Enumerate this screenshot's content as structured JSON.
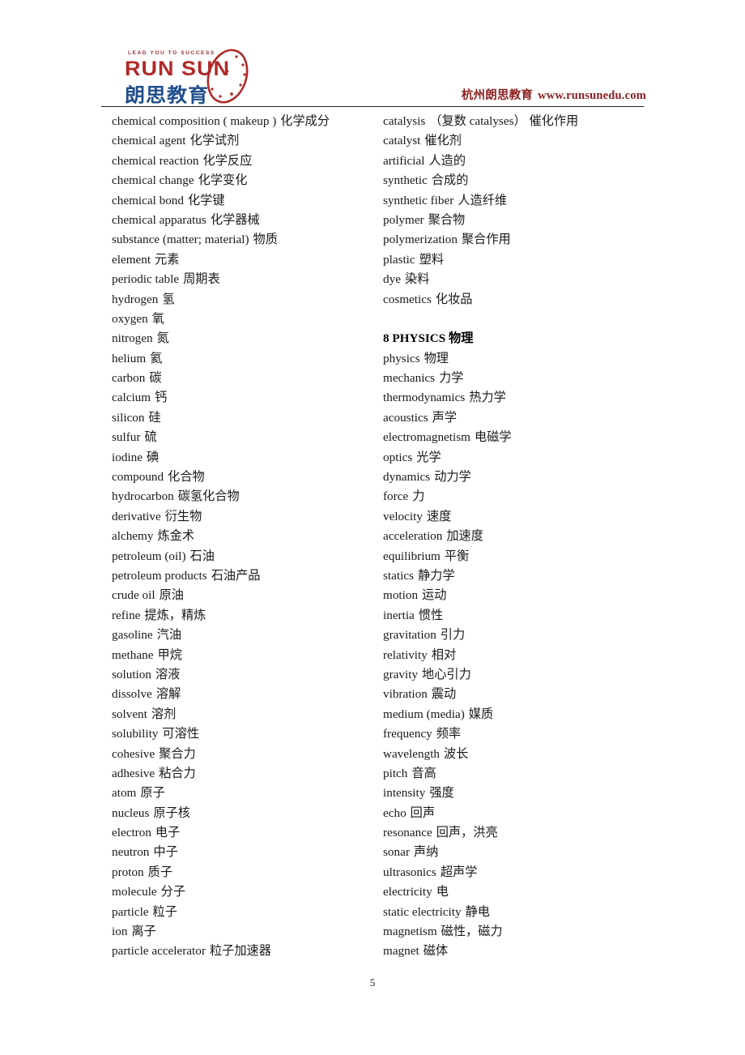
{
  "header": {
    "logo": {
      "tagline": "LEAD YOU TO SUCCESS",
      "name_en": "RUN SUN",
      "name_cn": "朗思教育"
    },
    "site_text": "杭州朗思教育",
    "site_url": "www.runsunedu.com",
    "brand_color": "#8b2121",
    "logo_blue": "#1f4e8c",
    "logo_red": "#b02a2a"
  },
  "left_column": [
    {
      "term": "chemical composition ( makeup )",
      "cn": "化学成分"
    },
    {
      "term": "chemical agent",
      "cn": "化学试剂"
    },
    {
      "term": "chemical reaction",
      "cn": "化学反应"
    },
    {
      "term": "chemical change",
      "cn": "化学变化"
    },
    {
      "term": "chemical bond",
      "cn": "化学键"
    },
    {
      "term": "chemical apparatus",
      "cn": "化学器械"
    },
    {
      "term": "substance (matter; material)",
      "cn": "物质"
    },
    {
      "term": "element",
      "cn": "元素"
    },
    {
      "term": "periodic table",
      "cn": "周期表"
    },
    {
      "term": "hydrogen",
      "cn": "氢"
    },
    {
      "term": "oxygen",
      "cn": "氧"
    },
    {
      "term": "nitrogen",
      "cn": "氮"
    },
    {
      "term": "helium",
      "cn": "氦"
    },
    {
      "term": "carbon",
      "cn": "碳"
    },
    {
      "term": "calcium",
      "cn": "钙"
    },
    {
      "term": "silicon",
      "cn": "硅"
    },
    {
      "term": "sulfur",
      "cn": "硫"
    },
    {
      "term": "iodine",
      "cn": "碘"
    },
    {
      "term": "compound",
      "cn": "化合物"
    },
    {
      "term": "hydrocarbon",
      "cn": "碳氢化合物"
    },
    {
      "term": "derivative",
      "cn": "衍生物"
    },
    {
      "term": "alchemy",
      "cn": "炼金术"
    },
    {
      "term": "petroleum (oil)",
      "cn": "石油"
    },
    {
      "term": "petroleum products",
      "cn": "石油产品"
    },
    {
      "term": "crude oil",
      "cn": "原油"
    },
    {
      "term": "refine",
      "cn": "提炼，精炼"
    },
    {
      "term": "gasoline",
      "cn": "汽油"
    },
    {
      "term": "methane",
      "cn": "甲烷"
    },
    {
      "term": "solution",
      "cn": "溶液"
    },
    {
      "term": "dissolve",
      "cn": "溶解"
    },
    {
      "term": "solvent",
      "cn": "溶剂"
    },
    {
      "term": "solubility",
      "cn": "可溶性"
    },
    {
      "term": "cohesive",
      "cn": "聚合力"
    },
    {
      "term": "adhesive",
      "cn": "粘合力"
    },
    {
      "term": "atom",
      "cn": "原子"
    },
    {
      "term": "nucleus",
      "cn": "原子核"
    },
    {
      "term": "electron",
      "cn": "电子"
    },
    {
      "term": "neutron",
      "cn": "中子"
    },
    {
      "term": "proton",
      "cn": "质子"
    },
    {
      "term": "molecule",
      "cn": "分子"
    },
    {
      "term": "particle",
      "cn": "粒子"
    },
    {
      "term": "ion",
      "cn": "离子"
    },
    {
      "term": "particle accelerator",
      "cn": "粒子加速器"
    }
  ],
  "right_column": [
    {
      "type": "entry",
      "term": "catalysis",
      "cn": "（复数 catalyses）  催化作用"
    },
    {
      "type": "entry",
      "term": "catalyst",
      "cn": "催化剂"
    },
    {
      "type": "entry",
      "term": "artificial",
      "cn": "人造的"
    },
    {
      "type": "entry",
      "term": "synthetic",
      "cn": "合成的"
    },
    {
      "type": "entry",
      "term": "synthetic fiber",
      "cn": "人造纤维"
    },
    {
      "type": "entry",
      "term": "polymer",
      "cn": "聚合物"
    },
    {
      "type": "entry",
      "term": "polymerization",
      "cn": "聚合作用"
    },
    {
      "type": "entry",
      "term": "plastic",
      "cn": "塑料"
    },
    {
      "type": "entry",
      "term": "dye",
      "cn": "染料"
    },
    {
      "type": "entry",
      "term": "cosmetics",
      "cn": "化妆品"
    },
    {
      "type": "blank",
      "term": "",
      "cn": ""
    },
    {
      "type": "heading",
      "term": "8 PHYSICS 物理",
      "cn": ""
    },
    {
      "type": "entry",
      "term": "physics",
      "cn": "物理"
    },
    {
      "type": "entry",
      "term": "mechanics",
      "cn": "力学"
    },
    {
      "type": "entry",
      "term": "thermodynamics",
      "cn": "热力学"
    },
    {
      "type": "entry",
      "term": "acoustics",
      "cn": "声学"
    },
    {
      "type": "entry",
      "term": "electromagnetism",
      "cn": "电磁学"
    },
    {
      "type": "entry",
      "term": "optics",
      "cn": "光学"
    },
    {
      "type": "entry",
      "term": "dynamics",
      "cn": "动力学"
    },
    {
      "type": "entry",
      "term": "force",
      "cn": "力"
    },
    {
      "type": "entry",
      "term": "velocity",
      "cn": "速度"
    },
    {
      "type": "entry",
      "term": "acceleration",
      "cn": "加速度"
    },
    {
      "type": "entry",
      "term": "equilibrium",
      "cn": "平衡"
    },
    {
      "type": "entry",
      "term": "statics",
      "cn": "静力学"
    },
    {
      "type": "entry",
      "term": "motion",
      "cn": "运动"
    },
    {
      "type": "entry",
      "term": "inertia",
      "cn": "惯性"
    },
    {
      "type": "entry",
      "term": "gravitation",
      "cn": "引力"
    },
    {
      "type": "entry",
      "term": "relativity",
      "cn": "相对"
    },
    {
      "type": "entry",
      "term": "gravity",
      "cn": "地心引力"
    },
    {
      "type": "entry",
      "term": "vibration",
      "cn": "震动"
    },
    {
      "type": "entry",
      "term": "medium (media)",
      "cn": "媒质"
    },
    {
      "type": "entry",
      "term": "frequency",
      "cn": "频率"
    },
    {
      "type": "entry",
      "term": "wavelength",
      "cn": "波长"
    },
    {
      "type": "entry",
      "term": "pitch",
      "cn": "音高"
    },
    {
      "type": "entry",
      "term": "intensity",
      "cn": "强度"
    },
    {
      "type": "entry",
      "term": "echo",
      "cn": "回声"
    },
    {
      "type": "entry",
      "term": "resonance",
      "cn": "回声，洪亮"
    },
    {
      "type": "entry",
      "term": "sonar",
      "cn": "声纳"
    },
    {
      "type": "entry",
      "term": "ultrasonics",
      "cn": "超声学"
    },
    {
      "type": "entry",
      "term": "electricity",
      "cn": "电"
    },
    {
      "type": "entry",
      "term": "static electricity",
      "cn": "静电"
    },
    {
      "type": "entry",
      "term": "magnetism",
      "cn": "磁性，磁力"
    },
    {
      "type": "entry",
      "term": "magnet",
      "cn": "磁体"
    }
  ],
  "footer": {
    "page_number": "5"
  }
}
